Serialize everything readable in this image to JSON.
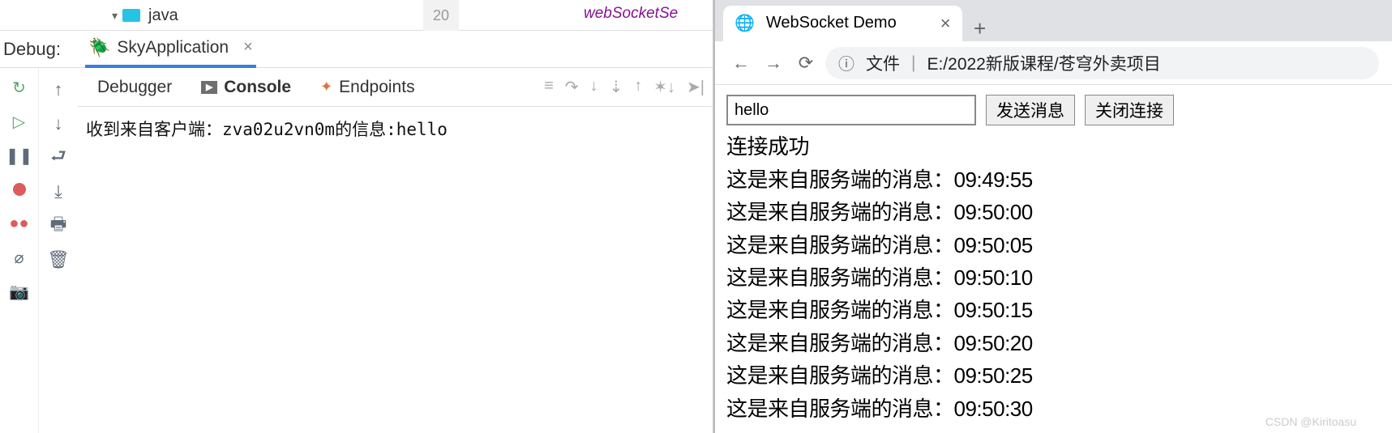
{
  "ide": {
    "tree": {
      "folder_name": "java"
    },
    "gutter_line": "20",
    "code_fragment": "webSocketSe",
    "debug_label": "Debug:",
    "run_config": "SkyApplication",
    "tabs": {
      "debugger": "Debugger",
      "console": "Console",
      "endpoints": "Endpoints"
    },
    "console_line": "收到来自客户端：zva02u2vn0m的信息:hello"
  },
  "browser": {
    "tab_title": "WebSocket Demo",
    "addr_prefix": "文件",
    "addr_path": "E:/2022新版课程/苍穹外卖项目",
    "input_value": "hello",
    "btn_send": "发送消息",
    "btn_close": "关闭连接",
    "messages": [
      "连接成功",
      "这是来自服务端的消息：09:49:55",
      "这是来自服务端的消息：09:50:00",
      "这是来自服务端的消息：09:50:05",
      "这是来自服务端的消息：09:50:10",
      "这是来自服务端的消息：09:50:15",
      "这是来自服务端的消息：09:50:20",
      "这是来自服务端的消息：09:50:25",
      "这是来自服务端的消息：09:50:30"
    ]
  },
  "watermark": "CSDN @Kiritoasu"
}
